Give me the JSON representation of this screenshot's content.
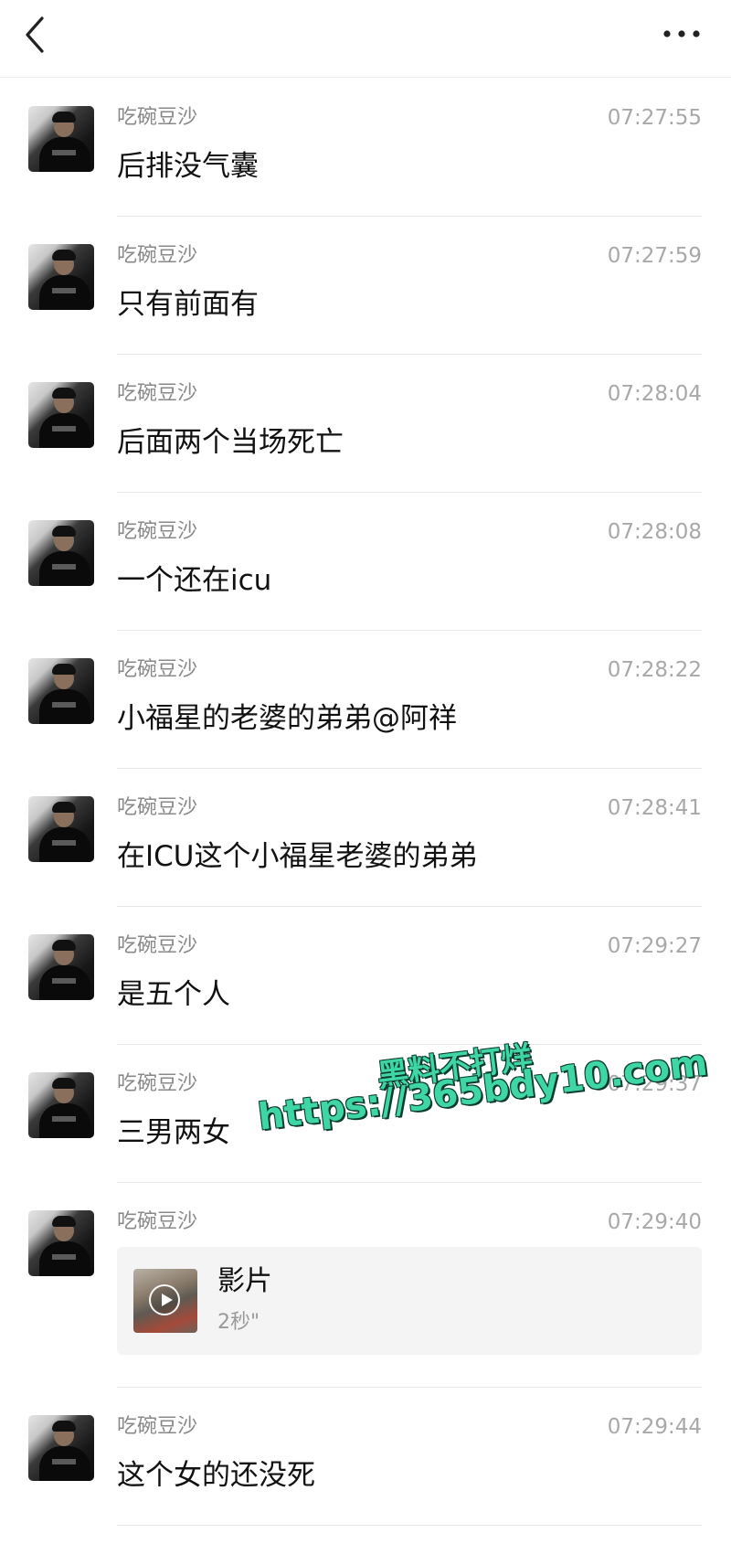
{
  "header": {
    "back_icon": "chevron-left-icon",
    "more_icon": "more-horizontal-icon"
  },
  "messages": [
    {
      "name": "吃碗豆沙",
      "time": "07:27:55",
      "text": "后排没气囊"
    },
    {
      "name": "吃碗豆沙",
      "time": "07:27:59",
      "text": "只有前面有"
    },
    {
      "name": "吃碗豆沙",
      "time": "07:28:04",
      "text": "后面两个当场死亡"
    },
    {
      "name": "吃碗豆沙",
      "time": "07:28:08",
      "text": "一个还在icu"
    },
    {
      "name": "吃碗豆沙",
      "time": "07:28:22",
      "text": "小福星的老婆的弟弟@阿祥"
    },
    {
      "name": "吃碗豆沙",
      "time": "07:28:41",
      "text": "在ICU这个小福星老婆的弟弟"
    },
    {
      "name": "吃碗豆沙",
      "time": "07:29:27",
      "text": "是五个人"
    },
    {
      "name": "吃碗豆沙",
      "time": "07:29:37",
      "text": "三男两女"
    },
    {
      "name": "吃碗豆沙",
      "time": "07:29:40",
      "video": {
        "title": "影片",
        "duration": "2秒\"",
        "icon": "play-icon"
      }
    },
    {
      "name": "吃碗豆沙",
      "time": "07:29:44",
      "text": "这个女的还没死"
    }
  ],
  "watermark": {
    "line1": "黑料不打烊",
    "line2": "https://365bdy10.com",
    "color": "#3fd6a6"
  }
}
